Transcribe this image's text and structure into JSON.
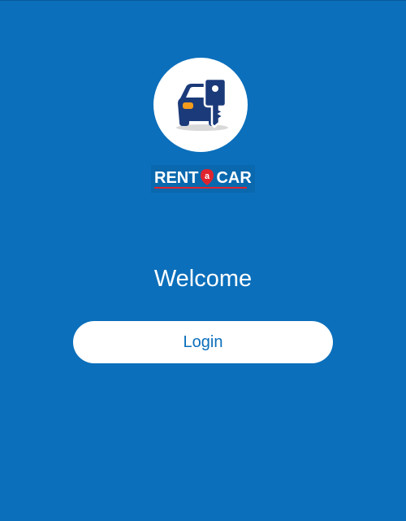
{
  "app": {
    "logo_icon": "car-with-key-icon",
    "brand_name": "RENT a CAR",
    "brand_left": "RENT",
    "brand_middle": "a",
    "brand_right": "CAR"
  },
  "main": {
    "welcome_text": "Welcome",
    "login_label": "Login"
  },
  "colors": {
    "background": "#0b6fbb",
    "button_background": "#ffffff",
    "button_text": "#0b6fbb",
    "brand_accent_red": "#e0242e",
    "icon_navy": "#1b3a7a",
    "icon_orange": "#f49b1c"
  }
}
